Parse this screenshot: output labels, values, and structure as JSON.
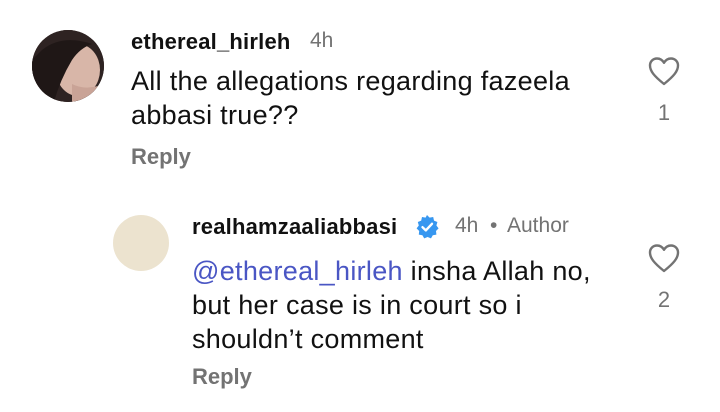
{
  "comments": [
    {
      "username": "ethereal_hirleh",
      "time": "4h",
      "text": "All the allegations regarding fazeela abbasi true??",
      "reply_label": "Reply",
      "like_count": "1"
    },
    {
      "username": "realhamzaaliabbasi",
      "time": "4h",
      "separator": "•",
      "author_label": "Author",
      "mention": "@ethereal_hirleh",
      "text": " insha Allah no, but her case is in court so i shouldn’t comment",
      "reply_label": "Reply",
      "like_count": "2"
    }
  ],
  "colors": {
    "mention": "#4a56c4",
    "verified": "#3797f0",
    "muted": "#737373"
  }
}
